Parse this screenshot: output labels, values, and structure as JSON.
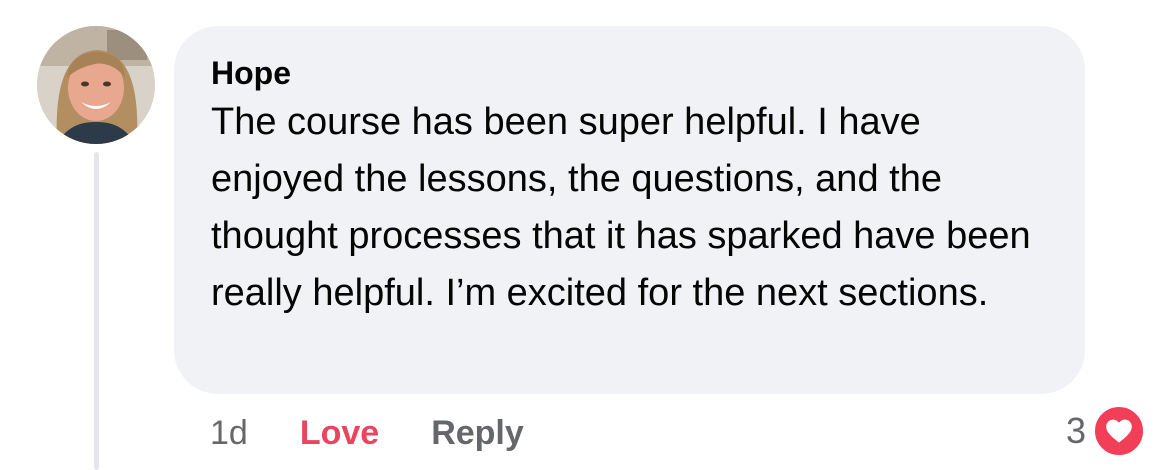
{
  "comment": {
    "author": "Hope",
    "text": "The course has been super helpful. I have enjoyed the lessons, the questions, and the thought processes that it has sparked have been really helpful. I’m excited for the next sections.",
    "time": "1d",
    "love_label": "Love",
    "reply_label": "Reply",
    "reaction_count": "3",
    "reaction_icon": "heart-icon",
    "colors": {
      "bubble": "#f0f2f5",
      "love": "#e8455f",
      "reaction": "#f33e58",
      "muted": "#65676b"
    }
  }
}
